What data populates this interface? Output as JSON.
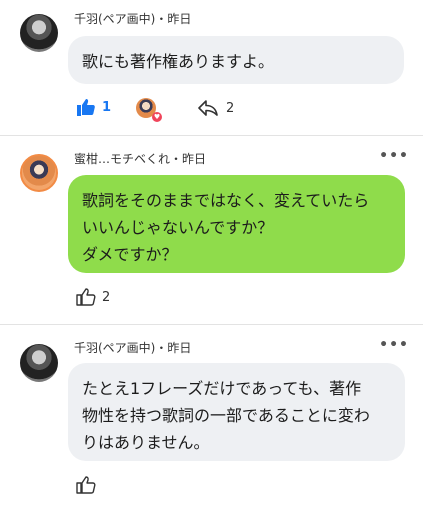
{
  "comments": [
    {
      "author": "千羽(ペア画中)",
      "time": "昨日",
      "lines": [
        "歌にも著作権ありますよ。"
      ],
      "like_count": "1",
      "share_count": "2"
    },
    {
      "author": "蜜柑…モチベくれ",
      "time": "昨日",
      "lines": [
        "歌詞をそのままではなく、変えていたら",
        "いいんじゃないんですか？",
        "ダメですか？"
      ],
      "like_count": "2"
    },
    {
      "author": "千羽(ペア画中)",
      "time": "昨日",
      "lines": [
        "たとえ1フレーズだけであっても、著作",
        "物性を持つ歌詞の一部であることに変わ",
        "りはありません。"
      ],
      "like_count": ""
    }
  ],
  "separator": "・",
  "more_label": "•••",
  "colors": {
    "like_active": "#1877f2",
    "green_bubble": "#8fdc4b",
    "gray_bubble": "#eef0f3"
  },
  "icons": {
    "like": "thumbs-up-icon",
    "share": "share-arrow-icon",
    "more": "more-dots-icon"
  }
}
